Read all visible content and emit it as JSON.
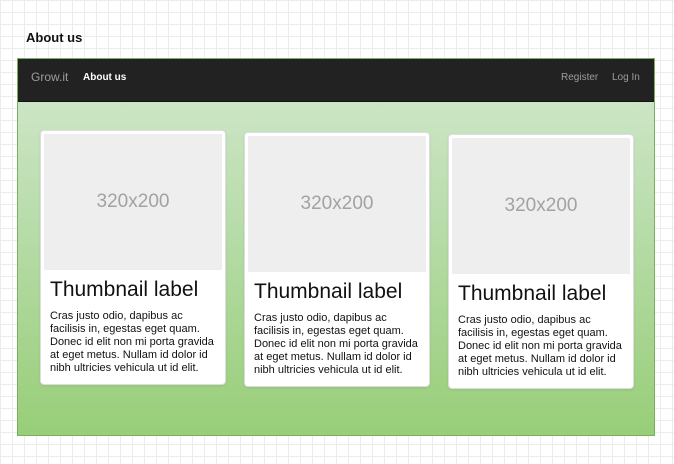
{
  "page": {
    "heading": "About us"
  },
  "navbar": {
    "brand": "Grow.it",
    "active_item": "About us",
    "register": "Register",
    "login": "Log In"
  },
  "thumbnails": [
    {
      "image_text": "320x200",
      "label": "Thumbnail label",
      "text": "Cras justo odio, dapibus ac facilisis in, egestas eget quam. Donec id elit non mi porta gravida at eget metus. Nullam id dolor id nibh ultricies vehicula ut id elit."
    },
    {
      "image_text": "320x200",
      "label": "Thumbnail label",
      "text": "Cras justo odio, dapibus ac facilisis in, egestas eget quam. Donec id elit non mi porta gravida at eget metus. Nullam id dolor id nibh ultricies vehicula ut id elit."
    },
    {
      "image_text": "320x200",
      "label": "Thumbnail label",
      "text": "Cras justo odio, dapibus ac facilisis in, egestas eget quam. Donec id elit non mi porta gravida at eget metus. Nullam id dolor id nibh ultricies vehicula ut id elit."
    }
  ],
  "colors": {
    "navbar_bg": "#222222",
    "nav_text": "#9d9d9d",
    "nav_active": "#ffffff",
    "content_gradient_top": "#d4e8cf",
    "content_gradient_bottom": "#98ce78",
    "placeholder_bg": "#eeeeee"
  }
}
